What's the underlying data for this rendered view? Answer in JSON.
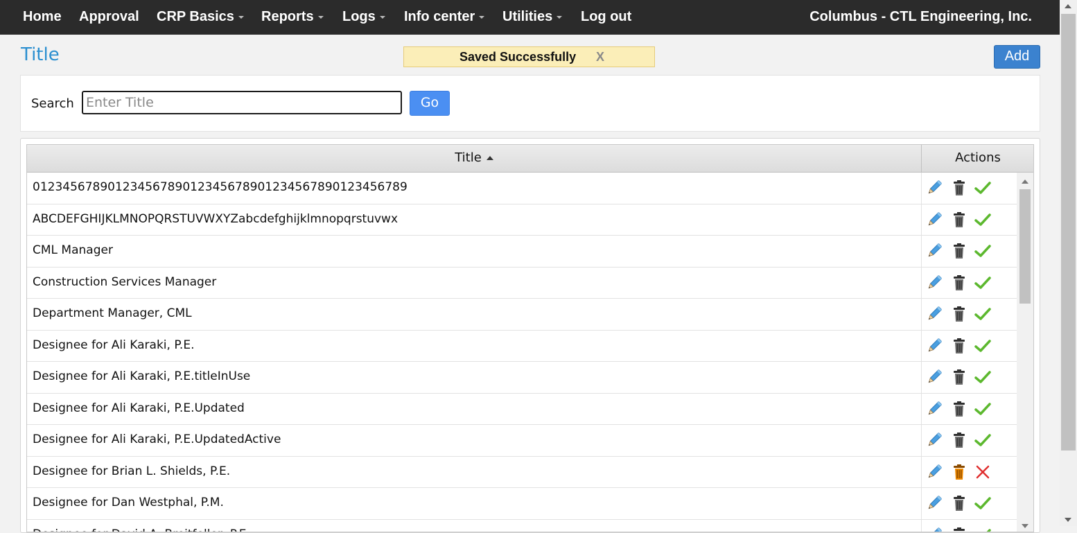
{
  "nav": {
    "items": [
      {
        "label": "Home",
        "dropdown": false
      },
      {
        "label": "Approval",
        "dropdown": false
      },
      {
        "label": "CRP Basics",
        "dropdown": true
      },
      {
        "label": "Reports",
        "dropdown": true
      },
      {
        "label": "Logs",
        "dropdown": true
      },
      {
        "label": "Info center",
        "dropdown": true
      },
      {
        "label": "Utilities",
        "dropdown": true
      },
      {
        "label": "Log out",
        "dropdown": false
      }
    ],
    "org": "Columbus  -  CTL Engineering, Inc."
  },
  "page": {
    "title": "Title",
    "toast_message": "Saved Successfully",
    "toast_close": "X",
    "add_label": "Add"
  },
  "search": {
    "label": "Search",
    "placeholder": "Enter Title",
    "value": "",
    "go_label": "Go"
  },
  "grid": {
    "columns": {
      "title": "Title",
      "actions": "Actions"
    },
    "sort": "ascending",
    "rows": [
      {
        "title": "0123456789012345678901234567890123456789012345678 9",
        "status": "active"
      },
      {
        "title": "ABCDEFGHIJKLMNOPQRSTUVWXYZabcdefghijklmnopqrstuvwx",
        "status": "active"
      },
      {
        "title": "CML Manager",
        "status": "active"
      },
      {
        "title": "Construction Services Manager",
        "status": "active"
      },
      {
        "title": "Department Manager, CML",
        "status": "active"
      },
      {
        "title": "Designee for Ali Karaki, P.E.",
        "status": "active"
      },
      {
        "title": "Designee for Ali Karaki, P.E.titleInUse",
        "status": "active"
      },
      {
        "title": "Designee for Ali Karaki, P.E.Updated",
        "status": "active"
      },
      {
        "title": "Designee for Ali Karaki, P.E.UpdatedActive",
        "status": "active"
      },
      {
        "title": "Designee for Brian L. Shields, P.E.",
        "status": "inactive"
      },
      {
        "title": "Designee for Dan Westphal, P.M.",
        "status": "active"
      },
      {
        "title": "Designee for David A. Breitfeller, P.E.",
        "status": "active"
      }
    ]
  },
  "icons": {
    "edit": "pencil-icon",
    "delete": "trash-icon",
    "active": "checkmark-icon",
    "inactive": "red-x-icon"
  },
  "colors": {
    "navbar": "#2b2b2b",
    "title_accent": "#2b8fd0",
    "add_button": "#3b82cf",
    "go_button": "#4b8ff2",
    "toast_bg": "#fbeeb8",
    "check": "#5cb82e",
    "cross": "#e03030",
    "trash_inactive": "#f08a00"
  }
}
